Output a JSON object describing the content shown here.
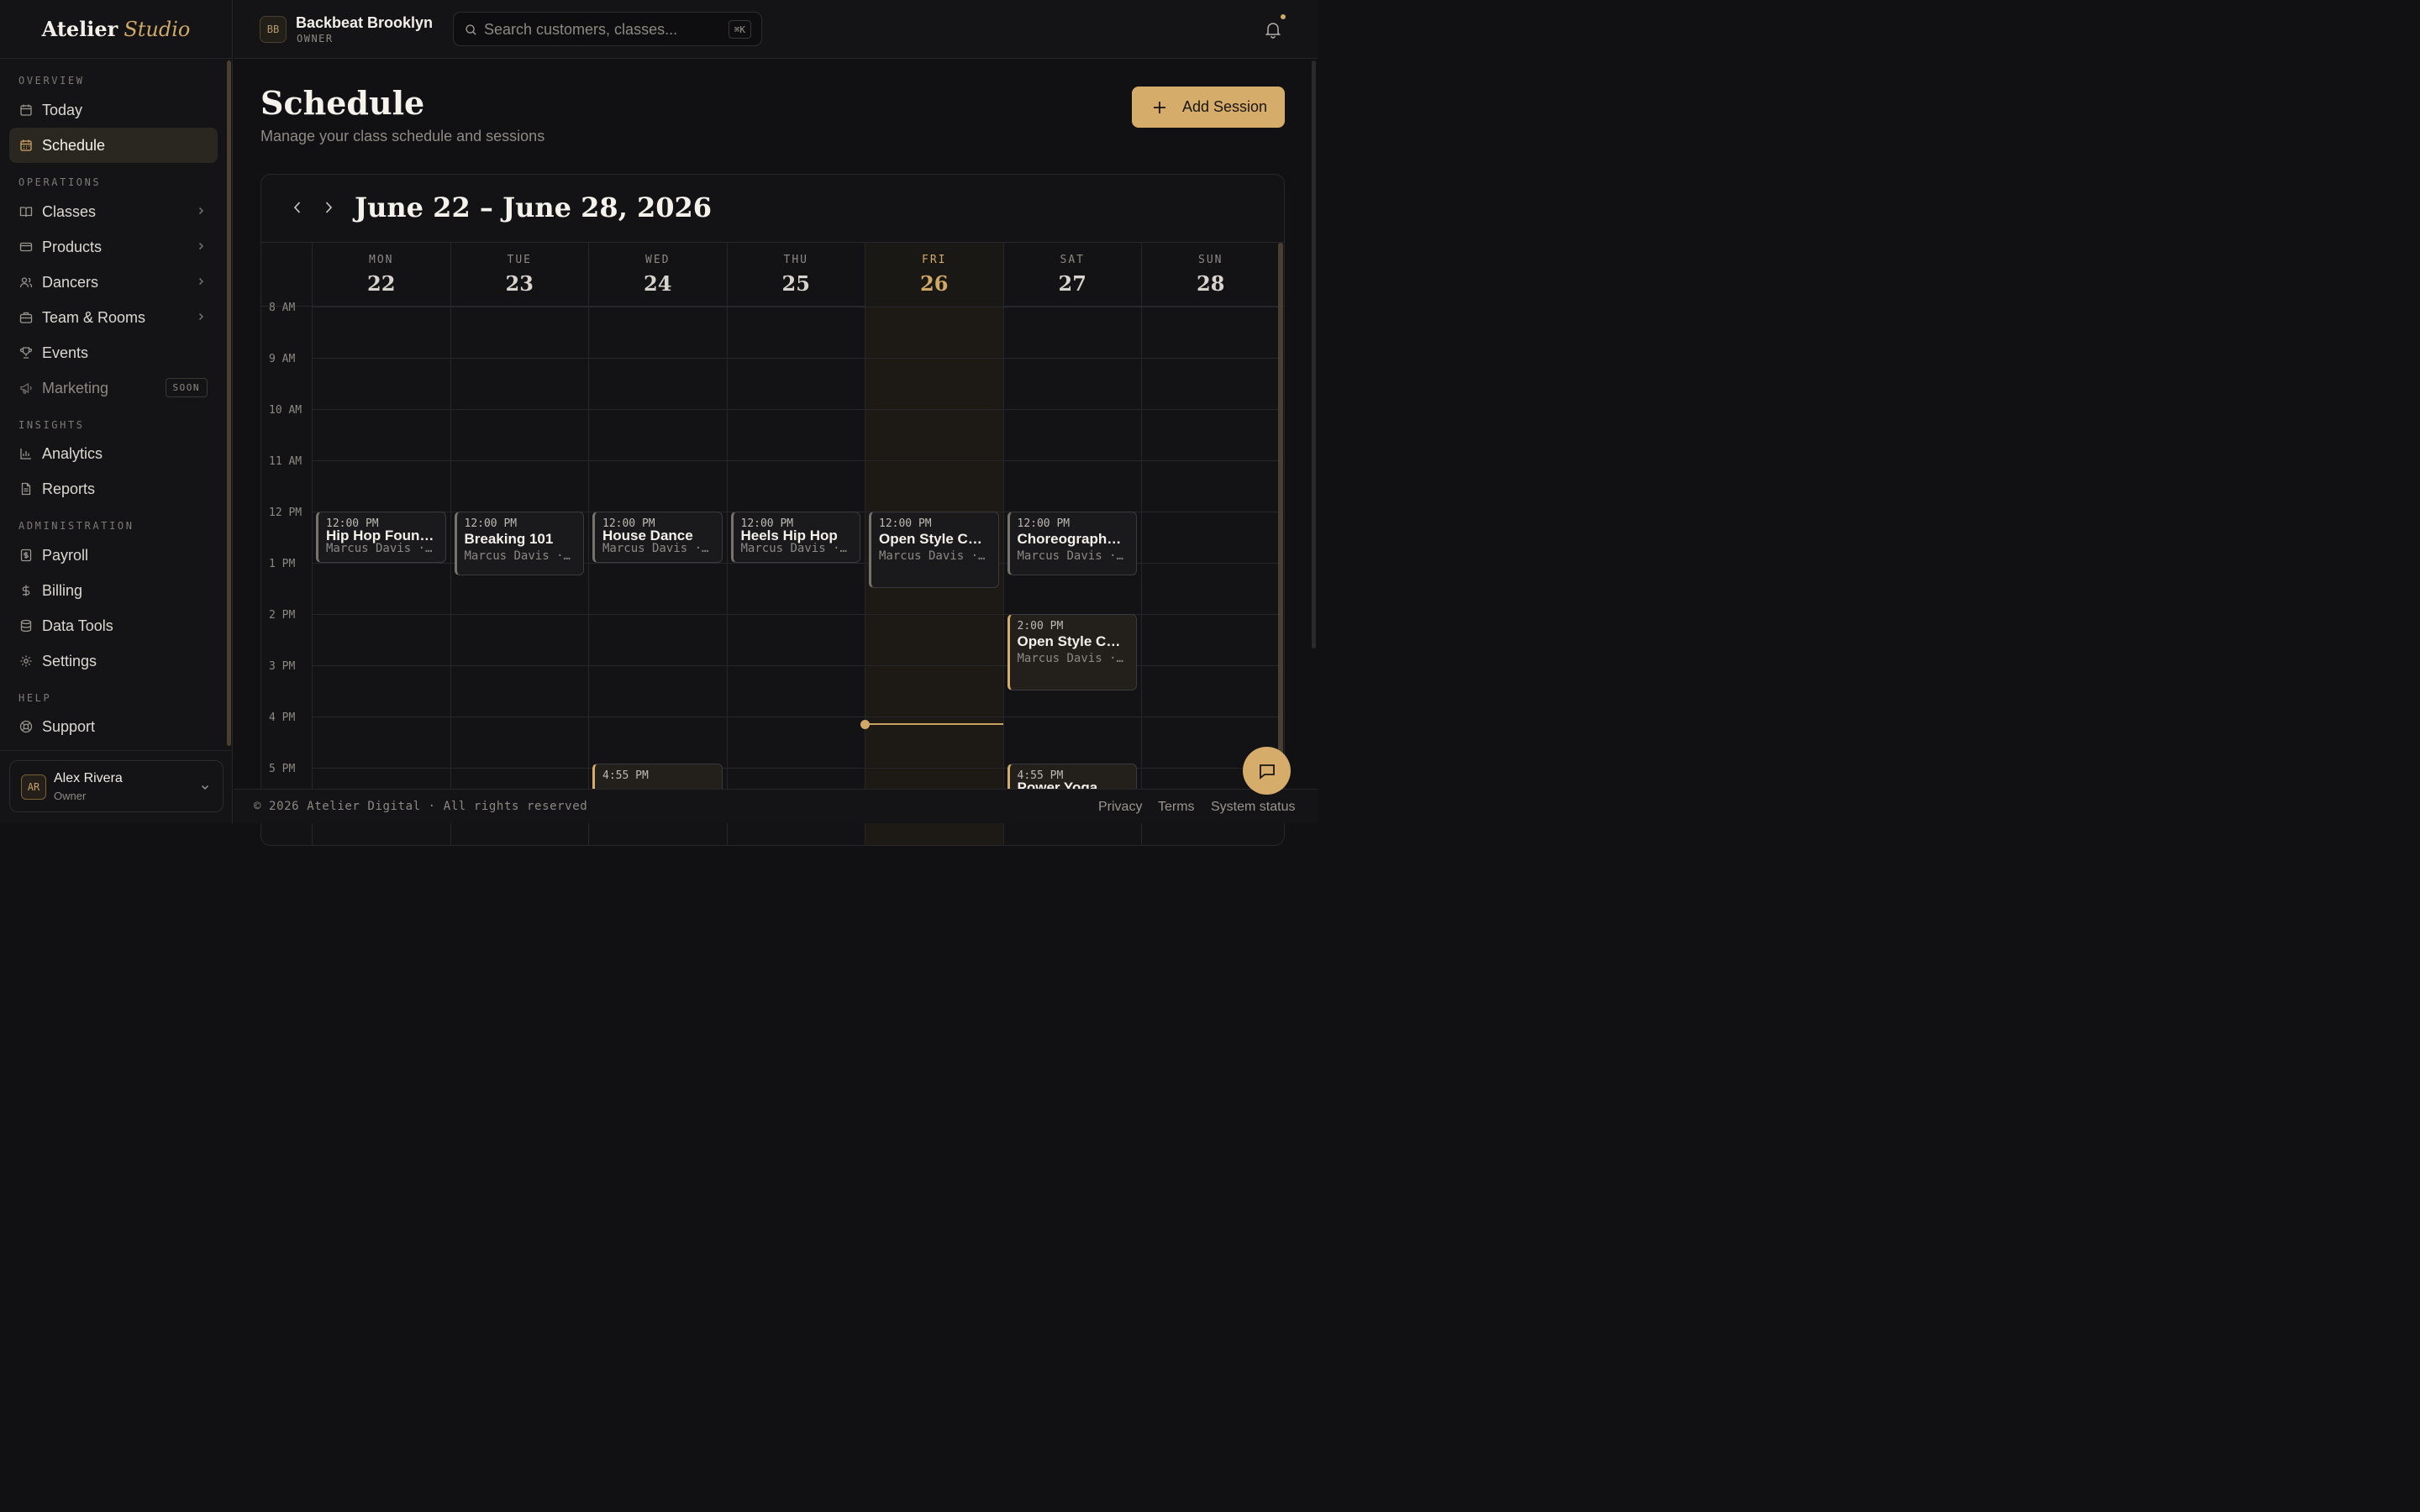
{
  "brand": {
    "name": "Atelier",
    "accent": "Studio"
  },
  "sidebar": {
    "sections": [
      {
        "label": "OVERVIEW"
      },
      {
        "label": "OPERATIONS"
      },
      {
        "label": "INSIGHTS"
      },
      {
        "label": "ADMINISTRATION"
      },
      {
        "label": "HELP"
      }
    ],
    "items": [
      {
        "label": "Today",
        "icon": "calendar-icon"
      },
      {
        "label": "Schedule",
        "icon": "calendar-grid-icon",
        "active": true
      },
      {
        "label": "Classes",
        "icon": "book-icon"
      },
      {
        "label": "Products",
        "icon": "credit-card-icon"
      },
      {
        "label": "Dancers",
        "icon": "users-icon"
      },
      {
        "label": "Team & Rooms",
        "icon": "building-icon"
      },
      {
        "label": "Events",
        "icon": "trophy-icon"
      },
      {
        "label": "Marketing",
        "icon": "megaphone-icon",
        "badge": "SOON"
      },
      {
        "label": "Analytics",
        "icon": "bar-chart-icon"
      },
      {
        "label": "Reports",
        "icon": "document-icon"
      },
      {
        "label": "Payroll",
        "icon": "receipt-icon"
      },
      {
        "label": "Billing",
        "icon": "dollar-icon"
      },
      {
        "label": "Data Tools",
        "icon": "database-icon"
      },
      {
        "label": "Settings",
        "icon": "gear-icon"
      },
      {
        "label": "Support",
        "icon": "lifebuoy-icon"
      }
    ],
    "user": {
      "initials": "AR",
      "name": "Alex Rivera",
      "role": "Owner"
    }
  },
  "topbar": {
    "org": {
      "initials": "BB",
      "name": "Backbeat Brooklyn",
      "role": "OWNER"
    },
    "search": {
      "placeholder": "Search customers, classes...",
      "shortcut": "⌘K"
    }
  },
  "main": {
    "title": "Schedule",
    "subtitle": "Manage your class schedule and sessions",
    "add_button": "Add Session"
  },
  "calendar": {
    "range_title": "June 22 – June 28, 2026",
    "days": [
      {
        "dow": "MON",
        "date": "22"
      },
      {
        "dow": "TUE",
        "date": "23"
      },
      {
        "dow": "WED",
        "date": "24"
      },
      {
        "dow": "THU",
        "date": "25"
      },
      {
        "dow": "FRI",
        "date": "26",
        "today": true
      },
      {
        "dow": "SAT",
        "date": "27"
      },
      {
        "dow": "SUN",
        "date": "28"
      }
    ],
    "hours": [
      "8 AM",
      "9 AM",
      "10 AM",
      "11 AM",
      "12 PM",
      "1 PM",
      "2 PM",
      "3 PM",
      "4 PM",
      "5 PM"
    ],
    "now_time": "4:08 PM",
    "events": [
      {
        "day": 0,
        "time": "12:00 PM",
        "title": "Hip Hop Founda...",
        "sub": "Marcus Davis · ..."
      },
      {
        "day": 1,
        "time": "12:00 PM",
        "title": "Breaking 101",
        "sub": "Marcus Davis · ..."
      },
      {
        "day": 2,
        "time": "12:00 PM",
        "title": "House Dance",
        "sub": "Marcus Davis · ..."
      },
      {
        "day": 3,
        "time": "12:00 PM",
        "title": "Heels Hip Hop",
        "sub": "Marcus Davis · ..."
      },
      {
        "day": 4,
        "time": "12:00 PM",
        "title": "Open Style Cyp...",
        "sub": "Marcus Davis · ..."
      },
      {
        "day": 5,
        "time": "12:00 PM",
        "title": "Choreography L...",
        "sub": "Marcus Davis · ..."
      },
      {
        "day": 5,
        "time": "2:00 PM",
        "title": "Open Style Cyp...",
        "sub": "Marcus Davis · ...",
        "accent": true
      },
      {
        "day": 2,
        "time": "4:55 PM",
        "title": "",
        "sub": "",
        "accent": true
      },
      {
        "day": 5,
        "time": "4:55 PM",
        "title": "Power Yoga",
        "sub": "",
        "accent": true
      }
    ]
  },
  "footer": {
    "copyright": "© 2026 Atelier Digital · All rights reserved",
    "links": [
      "Privacy",
      "Terms",
      "System status"
    ]
  },
  "colors": {
    "accent": "#d5ac6a",
    "background": "#111113",
    "panel": "#141416"
  }
}
